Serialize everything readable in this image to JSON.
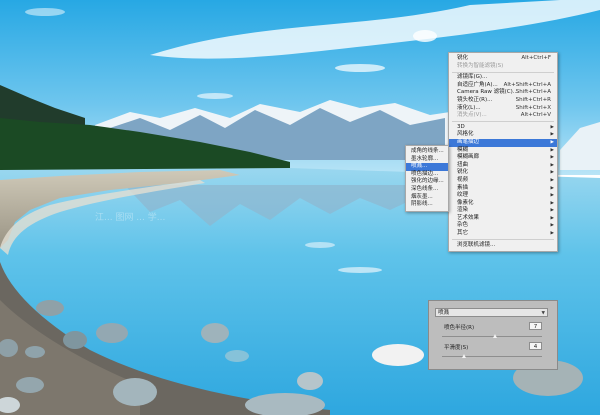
{
  "main_menu": {
    "items": [
      {
        "label": "锐化",
        "shortcut": "Alt+Ctrl+F",
        "disabled": false
      },
      {
        "label": "转换为智能滤镜(S)",
        "shortcut": "",
        "disabled": true
      },
      {
        "sep": true
      },
      {
        "label": "滤镜库(G)...",
        "shortcut": "",
        "disabled": false
      },
      {
        "label": "自适应广角(A)...",
        "shortcut": "Alt+Shift+Ctrl+A",
        "disabled": false
      },
      {
        "label": "Camera Raw 滤镜(C)...",
        "shortcut": "Shift+Ctrl+A",
        "disabled": false
      },
      {
        "label": "镜头校正(R)...",
        "shortcut": "Shift+Ctrl+R",
        "disabled": false
      },
      {
        "label": "液化(L)...",
        "shortcut": "Shift+Ctrl+X",
        "disabled": false
      },
      {
        "label": "消失点(V)...",
        "shortcut": "Alt+Ctrl+V",
        "disabled": true
      },
      {
        "sep": true
      },
      {
        "label": "3D",
        "submenu": true
      },
      {
        "label": "风格化",
        "submenu": true
      },
      {
        "label": "画笔描边",
        "submenu": true,
        "highlighted": true
      },
      {
        "label": "模糊",
        "submenu": true
      },
      {
        "label": "模糊画廊",
        "submenu": true
      },
      {
        "label": "扭曲",
        "submenu": true
      },
      {
        "label": "锐化",
        "submenu": true
      },
      {
        "label": "视频",
        "submenu": true
      },
      {
        "label": "素描",
        "submenu": true
      },
      {
        "label": "纹理",
        "submenu": true
      },
      {
        "label": "像素化",
        "submenu": true
      },
      {
        "label": "渲染",
        "submenu": true
      },
      {
        "label": "艺术效果",
        "submenu": true
      },
      {
        "label": "杂色",
        "submenu": true
      },
      {
        "label": "其它",
        "submenu": true
      },
      {
        "sep": true
      },
      {
        "label": "浏览联机滤镜..."
      }
    ]
  },
  "sub_menu": {
    "items": [
      {
        "label": "成角的线条..."
      },
      {
        "label": "墨水轮廓..."
      },
      {
        "label": "喷溅...",
        "highlighted": true
      },
      {
        "label": "喷色描边..."
      },
      {
        "label": "强化的边缘..."
      },
      {
        "label": "深色线条..."
      },
      {
        "label": "烟灰墨..."
      },
      {
        "label": "阴影线..."
      }
    ]
  },
  "filter_panel": {
    "filter_name": "喷溅",
    "param1_label": "喷色半径(R)",
    "param1_value": "7",
    "param2_label": "平滑度(S)",
    "param2_value": "4"
  },
  "watermark": "江... 图网 ... 学..."
}
